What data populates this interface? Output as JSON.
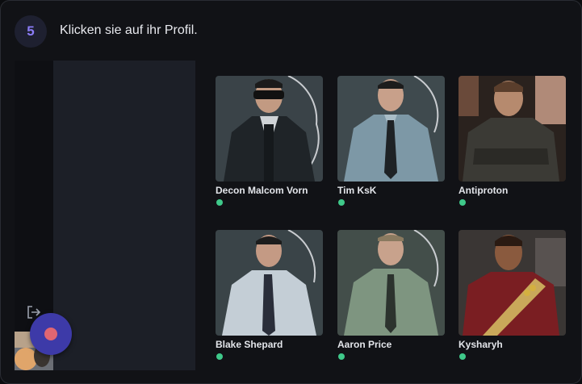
{
  "step": {
    "number": "5",
    "instruction": "Klicken sie auf ihr Profil."
  },
  "profiles": [
    {
      "name": "Decon Malcom Vorn",
      "online": true
    },
    {
      "name": "Tim KsK",
      "online": true
    },
    {
      "name": "Antiproton",
      "online": true
    },
    {
      "name": "Blake Shepard",
      "online": true
    },
    {
      "name": "Aaron Price",
      "online": true
    },
    {
      "name": "Kysharyh",
      "online": true
    }
  ],
  "colors": {
    "accent": "#8b7cf6",
    "online": "#3fc98a",
    "record": "#3d3aa8"
  },
  "icons": {
    "logout": "logout-icon",
    "record": "record-dot-icon"
  }
}
